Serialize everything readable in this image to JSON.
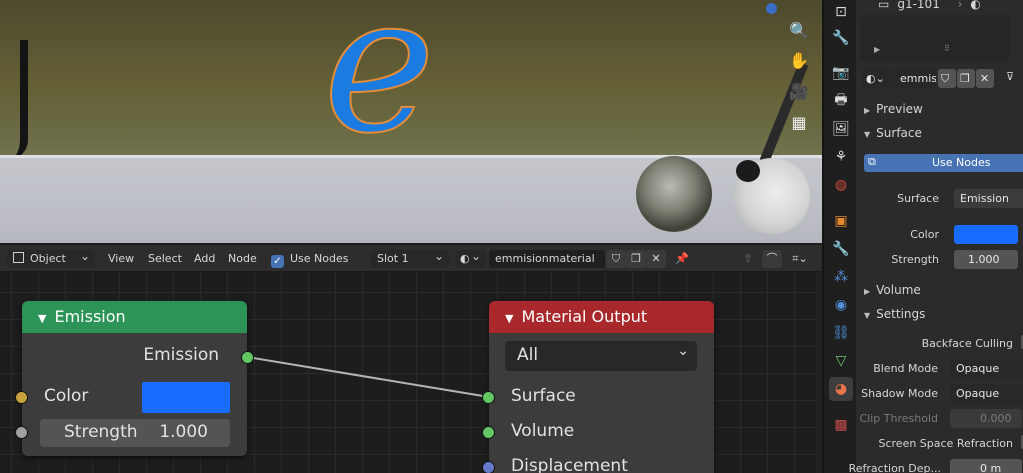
{
  "viewport": {
    "letter": "e",
    "nav_icons": [
      "zoom-icon",
      "hand-icon",
      "camera-icon",
      "grid-icon"
    ]
  },
  "node_header": {
    "mode": "Object",
    "menus": [
      "View",
      "Select",
      "Add",
      "Node"
    ],
    "use_nodes_label": "Use Nodes",
    "use_nodes_checked": true,
    "slot": "Slot 1",
    "material_name": "emmisionmaterial"
  },
  "emission_node": {
    "title": "Emission",
    "output_label": "Emission",
    "color_label": "Color",
    "color_value": "#1a6bff",
    "strength_label": "Strength",
    "strength_value": "1.000",
    "header_color": "#2d9457"
  },
  "output_node": {
    "title": "Material Output",
    "target": "All",
    "inputs": [
      "Surface",
      "Volume",
      "Displacement"
    ],
    "header_color": "#a8282c"
  },
  "properties": {
    "object_name": "g1-101",
    "material_short": "emmis",
    "sections": {
      "preview": "Preview",
      "surface": "Surface",
      "volume": "Volume",
      "settings": "Settings"
    },
    "use_nodes_button": "Use Nodes",
    "surface_label": "Surface",
    "surface_value": "Emission",
    "color_label": "Color",
    "color_value": "#1a6bff",
    "strength_label": "Strength",
    "strength_value": "1.000",
    "backface_label": "Backface Culling",
    "blend_label": "Blend Mode",
    "blend_value": "Opaque",
    "shadow_label": "Shadow Mode",
    "shadow_value": "Opaque",
    "clip_label": "Clip Threshold",
    "clip_value": "0.000",
    "ssr_label": "Screen Space Refraction",
    "refr_label": "Refraction Dep...",
    "refr_value": "0 m"
  }
}
